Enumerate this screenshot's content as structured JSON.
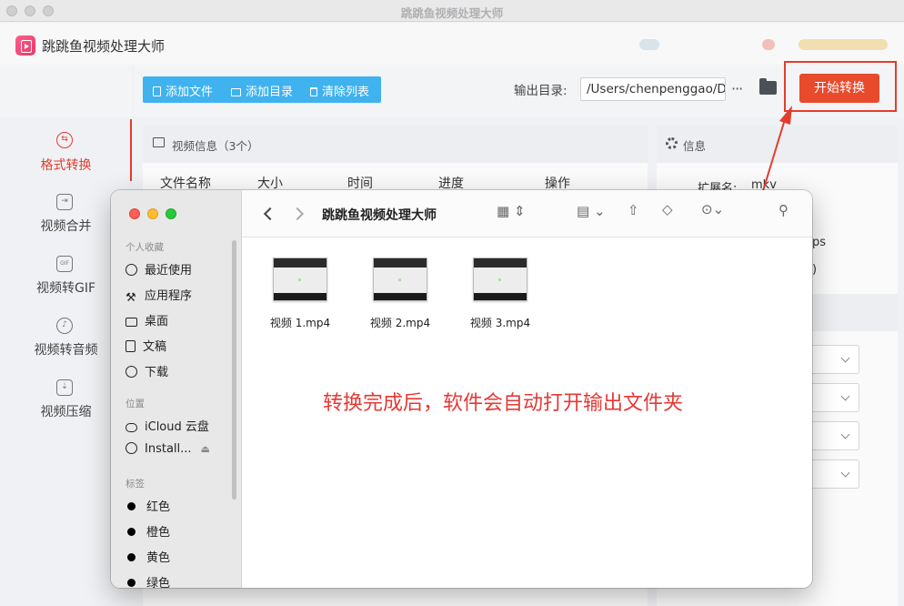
{
  "window": {
    "title": "跳跳鱼视频处理大师"
  },
  "app": {
    "title": "跳跳鱼视频处理大师"
  },
  "sidebar": {
    "items": [
      {
        "label": "格式转换",
        "icon": "format-convert-icon",
        "active": true
      },
      {
        "label": "视频合并",
        "icon": "video-merge-icon",
        "active": false
      },
      {
        "label": "视频转GIF",
        "icon": "gif-icon",
        "active": false
      },
      {
        "label": "视频转音频",
        "icon": "audio-icon",
        "active": false
      },
      {
        "label": "视频压缩",
        "icon": "compress-icon",
        "active": false
      }
    ]
  },
  "toolbar": {
    "add_file": "添加文件",
    "add_dir": "添加目录",
    "clear_list": "清除列表",
    "output_label": "输出目录:",
    "output_path": "/Users/chenpenggao/D",
    "more": "···",
    "start": "开始转换"
  },
  "video_panel": {
    "title": "视频信息（3个）",
    "columns": [
      "文件名称",
      "大小",
      "时间",
      "进度",
      "操作"
    ]
  },
  "info_panel": {
    "title": "信息",
    "ext_label": "扩展名:",
    "ext_value": "mkv",
    "fps_partial": "ps",
    "paren_partial": ")"
  },
  "finder": {
    "title": "跳跳鱼视频处理大师",
    "sections": {
      "favorites": "个人收藏",
      "locations": "位置",
      "tags": "标签"
    },
    "favorites": [
      "最近使用",
      "应用程序",
      "桌面",
      "文稿",
      "下载"
    ],
    "locations": [
      "iCloud 云盘",
      "Install..."
    ],
    "tags": [
      "红色",
      "橙色",
      "黄色",
      "绿色"
    ],
    "files": [
      "视频 1.mp4",
      "视频 2.mp4",
      "视频 3.mp4"
    ],
    "note": "转换完成后，软件会自动打开输出文件夹"
  },
  "colors": {
    "accent": "#e03e2d",
    "toolbar_blue": "#3fb2ef",
    "start_btn": "#e84a2c",
    "note_red": "#e53935"
  }
}
